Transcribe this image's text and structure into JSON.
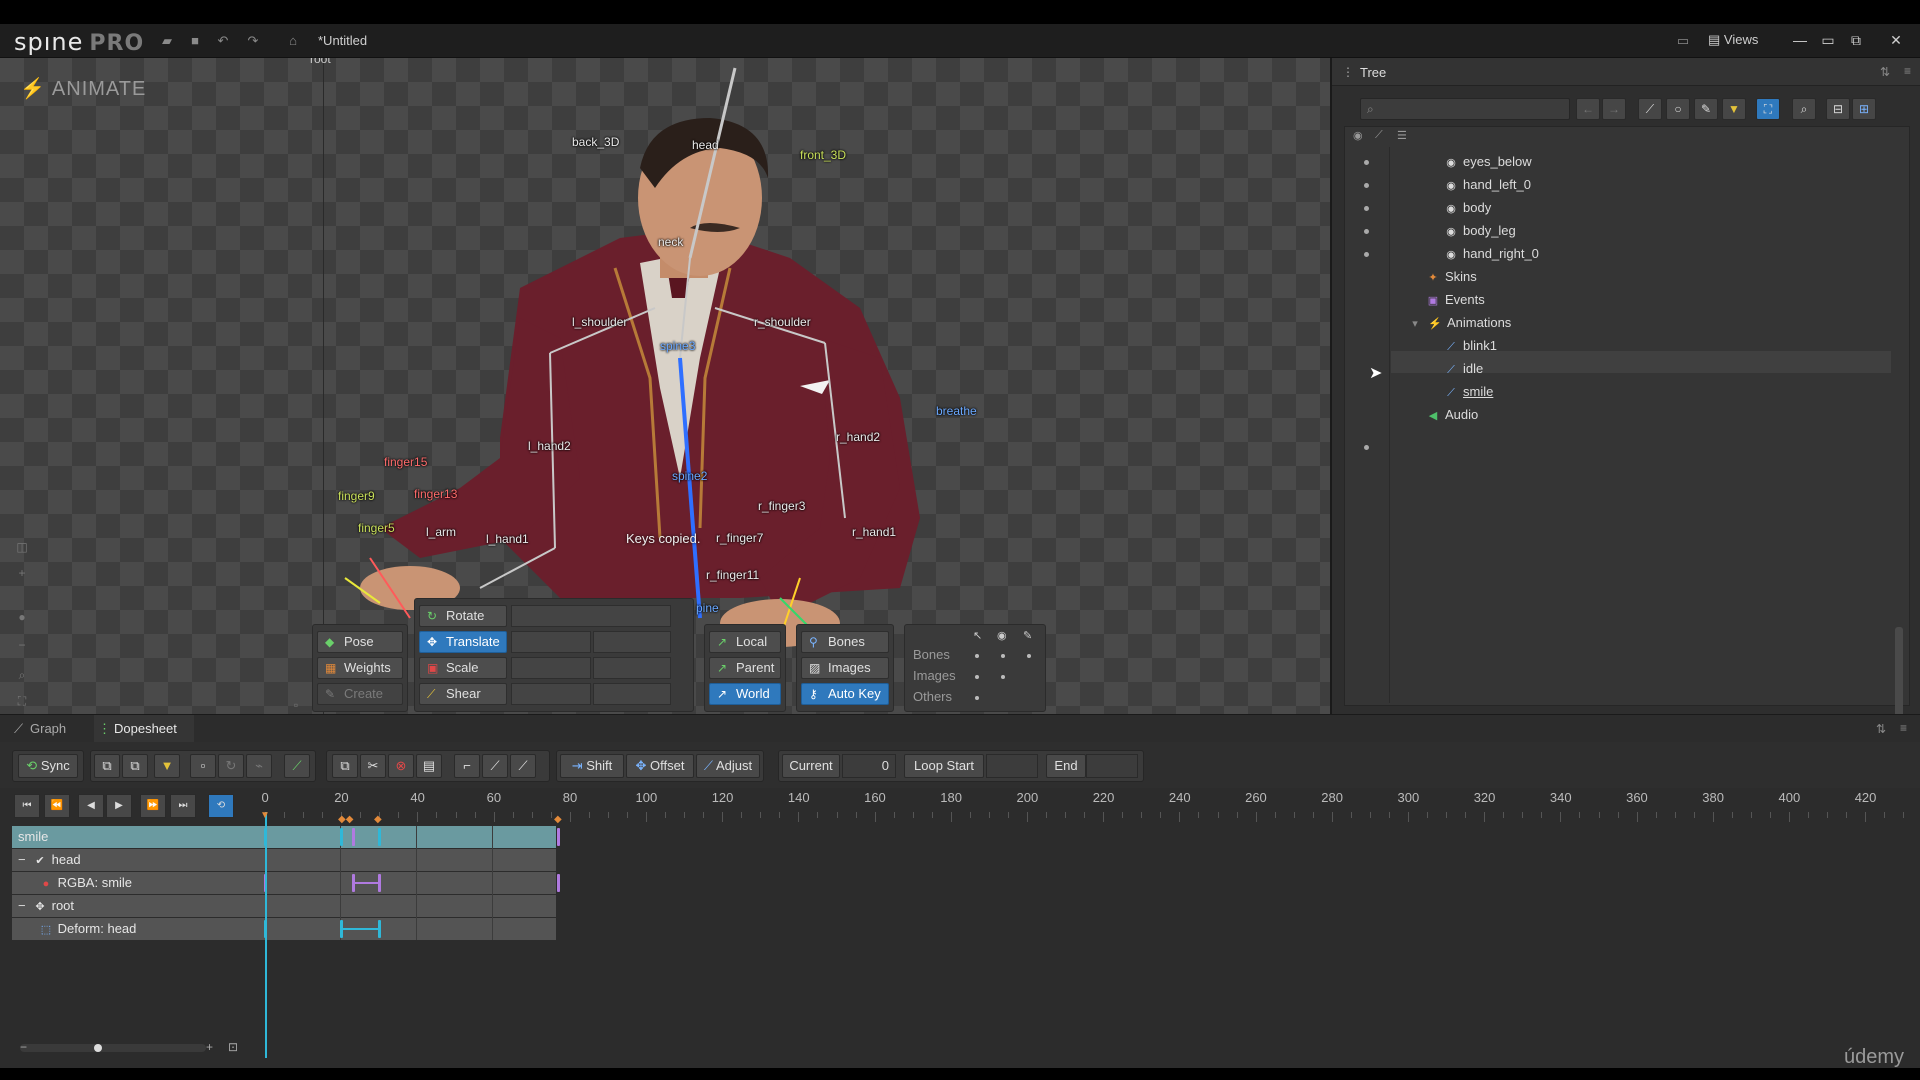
{
  "app": {
    "logo": "spıne",
    "edition": "PRO",
    "title": "*Untitled",
    "views_label": "Views"
  },
  "viewport": {
    "mode": "ANIMATE",
    "root_label": "root",
    "status_message": "Keys copied.",
    "bones": [
      "back_3D",
      "head",
      "front_3D",
      "neck",
      "l_shoulder",
      "r_shoulder",
      "spine3",
      "breathe",
      "l_hand2",
      "r_hand2",
      "finger15",
      "finger9",
      "finger13",
      "finger5",
      "l_arm",
      "l_hand1",
      "spine2",
      "r_finger3",
      "r_finger7",
      "r_hand1",
      "r_finger11",
      "pine"
    ]
  },
  "tools": {
    "left": [
      "Pose",
      "Weights",
      "Create"
    ],
    "transform": [
      "Rotate",
      "Translate",
      "Scale",
      "Shear"
    ],
    "axes": [
      "Local",
      "Parent",
      "World"
    ],
    "view": [
      "Bones",
      "Images",
      "Auto Key"
    ],
    "options_rows": [
      "Bones",
      "Images",
      "Others"
    ]
  },
  "tree": {
    "title": "Tree",
    "search_placeholder": "",
    "items": [
      {
        "label": "eyes_below",
        "icon": "slot-icon"
      },
      {
        "label": "hand_left_0",
        "icon": "slot-icon"
      },
      {
        "label": "body",
        "icon": "slot-icon"
      },
      {
        "label": "body_leg",
        "icon": "slot-icon"
      },
      {
        "label": "hand_right_0",
        "icon": "slot-icon"
      },
      {
        "label": "Skins",
        "icon": "skins-icon"
      },
      {
        "label": "Events",
        "icon": "events-icon"
      },
      {
        "label": "Animations",
        "icon": "animations-icon"
      },
      {
        "label": "blink1",
        "icon": "animation-icon"
      },
      {
        "label": "idle",
        "icon": "animation-icon"
      },
      {
        "label": "smile",
        "icon": "animation-icon"
      },
      {
        "label": "Audio",
        "icon": "audio-icon"
      }
    ]
  },
  "bottom": {
    "tabs": [
      "Graph",
      "Dopesheet"
    ],
    "toolbar": {
      "sync": "Sync",
      "shift": "Shift",
      "offset": "Offset",
      "adjust": "Adjust",
      "current_label": "Current",
      "current_value": "0",
      "loop_start_label": "Loop Start",
      "end_label": "End"
    },
    "ruler": [
      "0",
      "20",
      "40",
      "60",
      "80",
      "100",
      "120",
      "140",
      "160",
      "180",
      "200",
      "220",
      "240",
      "260",
      "280",
      "300",
      "320",
      "340",
      "360",
      "380",
      "400",
      "420"
    ],
    "tracks": [
      "smile",
      "head",
      "RGBA: smile",
      "root",
      "Deform: head"
    ]
  },
  "watermark": "údemy",
  "colors": {
    "accent": "#2f79bd",
    "playhead": "#2fb8d8",
    "track_highlight": "#6a9aa0"
  }
}
